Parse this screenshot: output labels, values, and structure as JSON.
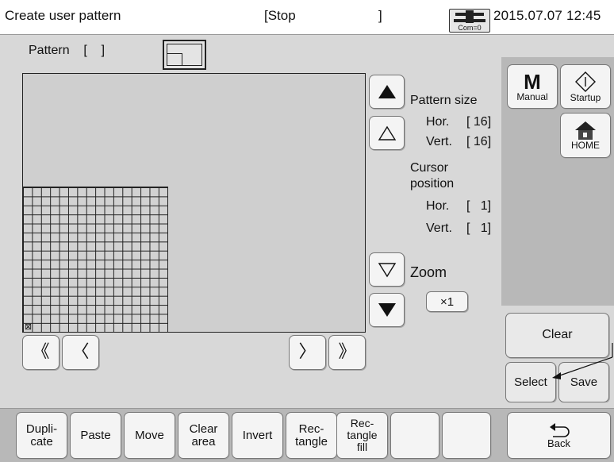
{
  "header": {
    "title": "Create user pattern",
    "status": "[Stop",
    "status_close": "]",
    "com_label": "Com=0",
    "datetime": "2015.07.07 12:45"
  },
  "pattern": {
    "label": "Pattern    [    ]"
  },
  "canvas": {
    "cursor_mark": "⊠"
  },
  "info": {
    "pattern_size_label": "Pattern size",
    "hor_label": "Hor.",
    "hor_value": "[ 16]",
    "vert_label": "Vert.",
    "vert_value": "[ 16]",
    "cursor_line1": "Cursor",
    "cursor_line2": "position",
    "cur_hor_label": "Hor.",
    "cur_hor_value": "[   1]",
    "cur_vert_label": "Vert.",
    "cur_vert_value": "[   1]",
    "zoom_label": "Zoom",
    "zoom_value": "×1"
  },
  "nav": {
    "first": "《",
    "prev": "〈",
    "next": "〉",
    "last": "》"
  },
  "right": {
    "manual_big": "M",
    "manual_label": "Manual",
    "startup_label": "Startup",
    "home_label": "HOME",
    "clear_label": "Clear",
    "select_label": "Select",
    "save_label": "Save",
    "back_label": "Back"
  },
  "bottom": {
    "duplicate": "Dupli-\ncate",
    "paste": "Paste",
    "move": "Move",
    "clear_area": "Clear\narea",
    "invert": "Invert",
    "rectangle": "Rec-\ntangle",
    "rectangle_fill": "Rec-\ntangle\nfill"
  },
  "icons": {
    "up_fill": "triangle-up-filled-icon",
    "up_outline": "triangle-up-outline-icon",
    "down_outline": "triangle-down-outline-icon",
    "down_fill": "triangle-down-filled-icon",
    "home": "home-icon",
    "startup": "startup-diamond-icon",
    "back": "back-arrow-icon",
    "com": "communication-plug-icon"
  }
}
